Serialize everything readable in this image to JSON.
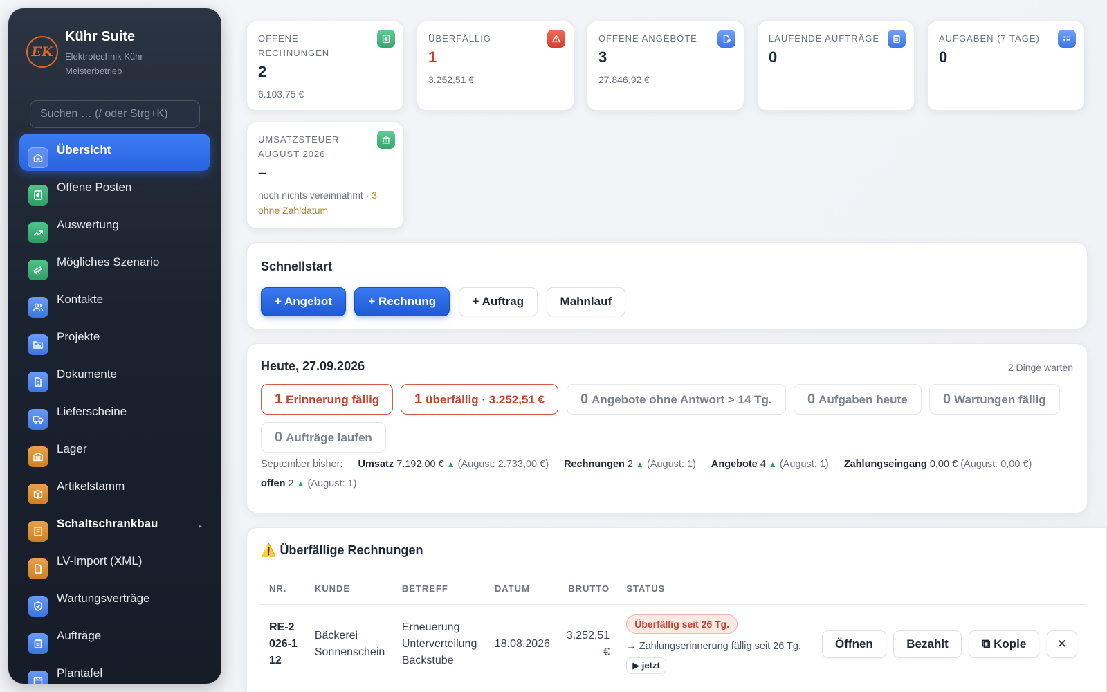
{
  "brand": {
    "logo_text": "EK",
    "title": "Kühr Suite",
    "sub1": "Elektrotechnik Kühr",
    "sub2": "Meisterbetrieb"
  },
  "search": {
    "placeholder": "Suchen … (/ oder Strg+K)"
  },
  "nav": [
    {
      "label": "Übersicht",
      "icon": "home-icon",
      "color": "active"
    },
    {
      "label": "Offene Posten",
      "icon": "euro-icon",
      "color": "green"
    },
    {
      "label": "Auswertung",
      "icon": "trend-up-icon",
      "color": "green"
    },
    {
      "label": "Mögliches Szenario",
      "icon": "telescope-icon",
      "color": "green"
    },
    {
      "label": "Kontakte",
      "icon": "users-icon",
      "color": "blue"
    },
    {
      "label": "Projekte",
      "icon": "folder-icon",
      "color": "blue"
    },
    {
      "label": "Dokumente",
      "icon": "document-icon",
      "color": "blue"
    },
    {
      "label": "Lieferscheine",
      "icon": "truck-icon",
      "color": "blue"
    },
    {
      "label": "Lager",
      "icon": "warehouse-icon",
      "color": "orange"
    },
    {
      "label": "Artikelstamm",
      "icon": "box-icon",
      "color": "orange"
    },
    {
      "label": "Schaltschrankbau",
      "icon": "cabinet-icon",
      "color": "orange"
    },
    {
      "label": "LV-Import (XML)",
      "icon": "file-xml-icon",
      "color": "orange"
    },
    {
      "label": "Wartungsverträge",
      "icon": "shield-icon",
      "color": "blue"
    },
    {
      "label": "Aufträge",
      "icon": "clipboard-icon",
      "color": "blue"
    },
    {
      "label": "Plantafel",
      "icon": "calendar-icon",
      "color": "blue"
    }
  ],
  "kpis": {
    "offene_rechnungen": {
      "label": "Offene Rechnungen",
      "value": "2",
      "sub": "6.103,75 €"
    },
    "ueberfaellig": {
      "label": "Überfällig",
      "value": "1",
      "sub": "3.252,51 €"
    },
    "offene_angebote": {
      "label": "Offene Angebote",
      "value": "3",
      "sub": "27.846,92 €"
    },
    "laufende_auftraege": {
      "label": "Laufende Aufträge",
      "value": "0"
    },
    "aufgaben": {
      "label": "Aufgaben (7 Tage)",
      "value": "0"
    },
    "ust": {
      "label": "Umsatzsteuer August 2026",
      "value": "–",
      "sub_a": "noch nichts vereinnahmt · ",
      "sub_b": "3 ohne Zahldatum"
    }
  },
  "schnellstart": {
    "title": "Schnellstart",
    "angebot": "+ Angebot",
    "rechnung": "+ Rechnung",
    "auftrag": "+ Auftrag",
    "mahnlauf": "Mahnlauf"
  },
  "heute": {
    "title": "Heute, 27.09.2026",
    "waiting": "2 Dinge warten",
    "chips": [
      {
        "num": "1",
        "text": "Erinnerung fällig"
      },
      {
        "num": "1",
        "text": "überfällig · 3.252,51 €"
      },
      {
        "num": "0",
        "text": "Angebote ohne Antwort > 14 Tg."
      },
      {
        "num": "0",
        "text": "Aufgaben heute"
      },
      {
        "num": "0",
        "text": "Wartungen fällig"
      },
      {
        "num": "0",
        "text": "Aufträge laufen"
      }
    ],
    "stats": {
      "prefix": "September bisher:",
      "umsatz_label": "Umsatz",
      "umsatz_val": "7.192,00 €",
      "umsatz_prev": "(August: 2.733,00 €)",
      "rechnungen_label": "Rechnungen",
      "rechnungen_val": "2",
      "rechnungen_prev": "(August: 1)",
      "angebote_label": "Angebote",
      "angebote_val": "4",
      "angebote_prev": "(August: 1)",
      "zahlung_label": "Zahlungseingang",
      "zahlung_val": "0,00 €",
      "zahlung_prev": "(August: 0,00 €)",
      "offen_label": "offen",
      "offen_val": "2",
      "offen_prev": "(August: 1)",
      "arrow": "▲"
    }
  },
  "overdue": {
    "title": "Überfällige Rechnungen",
    "columns": {
      "nr": "Nr.",
      "kunde": "Kunde",
      "betreff": "Betreff",
      "datum": "Datum",
      "brutto": "Brutto",
      "status": "Status"
    },
    "row": {
      "nr": "RE-2026-112",
      "kunde": "Bäckerei Sonnenschein",
      "betreff": "Erneuerung Unterverteilung Backstube",
      "datum": "18.08.2026",
      "brutto": "3.252,51 €",
      "badge": "Überfällig seit 26 Tg.",
      "hint": "→ Zahlungserinnerung fällig seit 26 Tg.",
      "now": "▶ jetzt",
      "open": "Öffnen",
      "paid": "Bezahlt",
      "copy": "⧉ Kopie",
      "close": "✕"
    }
  }
}
